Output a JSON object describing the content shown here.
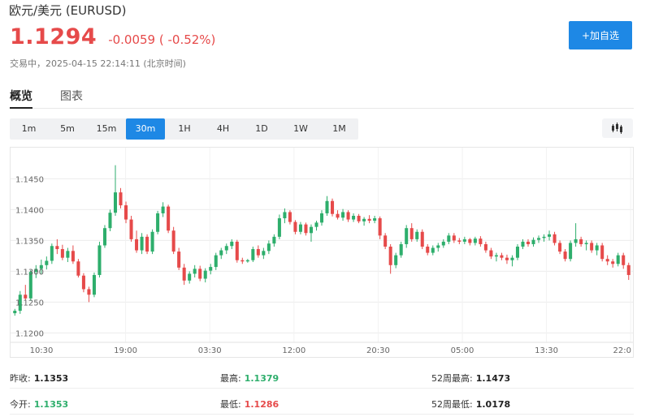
{
  "header": {
    "title": "欧元/美元 (EURUSD)",
    "price": "1.1294",
    "change": "-0.0059 ( -0.52%)",
    "trade_status": "交易中，2025-04-15 22:14:11 (北京时间)",
    "add_button": "+加自选"
  },
  "tabs": [
    {
      "label": "概览",
      "active": true
    },
    {
      "label": "图表",
      "active": false
    }
  ],
  "periods": [
    {
      "label": "1m",
      "active": false
    },
    {
      "label": "5m",
      "active": false
    },
    {
      "label": "15m",
      "active": false
    },
    {
      "label": "30m",
      "active": true
    },
    {
      "label": "1H",
      "active": false
    },
    {
      "label": "4H",
      "active": false
    },
    {
      "label": "1D",
      "active": false
    },
    {
      "label": "1W",
      "active": false
    },
    {
      "label": "1M",
      "active": false
    }
  ],
  "chart_data": {
    "type": "candlestick",
    "ylim": [
      1.119,
      1.149
    ],
    "y_ticks": [
      "1.1450",
      "1.1400",
      "1.1350",
      "1.1300",
      "1.1250",
      "1.1200"
    ],
    "y_tick_values": [
      1.145,
      1.14,
      1.135,
      1.13,
      1.125,
      1.12
    ],
    "x_ticks": [
      "10:30",
      "19:00",
      "03:30",
      "12:00",
      "20:30",
      "05:00",
      "13:30",
      "22:0"
    ],
    "grid": true,
    "up_color": "#2eae6c",
    "down_color": "#e64a4a",
    "candles": [
      [
        1.1232,
        1.1239,
        1.1228,
        1.1236
      ],
      [
        1.1236,
        1.1268,
        1.1231,
        1.1262
      ],
      [
        1.1262,
        1.1278,
        1.1253,
        1.1256
      ],
      [
        1.1256,
        1.1302,
        1.1252,
        1.1299
      ],
      [
        1.1299,
        1.131,
        1.1289,
        1.1304
      ],
      [
        1.1304,
        1.1319,
        1.1296,
        1.131
      ],
      [
        1.131,
        1.1324,
        1.1303,
        1.1317
      ],
      [
        1.1317,
        1.1345,
        1.1312,
        1.1341
      ],
      [
        1.1341,
        1.1352,
        1.1328,
        1.1336
      ],
      [
        1.1336,
        1.1343,
        1.1318,
        1.1322
      ],
      [
        1.1322,
        1.1338,
        1.1315,
        1.1333
      ],
      [
        1.1333,
        1.1342,
        1.1312,
        1.1316
      ],
      [
        1.1316,
        1.132,
        1.129,
        1.1293
      ],
      [
        1.1293,
        1.1297,
        1.1266,
        1.1271
      ],
      [
        1.1271,
        1.1275,
        1.125,
        1.1262
      ],
      [
        1.1262,
        1.1298,
        1.1258,
        1.1294
      ],
      [
        1.1294,
        1.1348,
        1.129,
        1.1342
      ],
      [
        1.1342,
        1.1375,
        1.1338,
        1.137
      ],
      [
        1.137,
        1.14,
        1.1365,
        1.1395
      ],
      [
        1.1395,
        1.1472,
        1.139,
        1.1428
      ],
      [
        1.1428,
        1.1435,
        1.1402,
        1.1407
      ],
      [
        1.1407,
        1.1413,
        1.1378,
        1.1384
      ],
      [
        1.1384,
        1.139,
        1.1348,
        1.1352
      ],
      [
        1.1352,
        1.1366,
        1.133,
        1.1334
      ],
      [
        1.1334,
        1.1362,
        1.1328,
        1.1356
      ],
      [
        1.1356,
        1.136,
        1.1328,
        1.1332
      ],
      [
        1.1332,
        1.1368,
        1.1328,
        1.1364
      ],
      [
        1.1364,
        1.1398,
        1.136,
        1.1394
      ],
      [
        1.1394,
        1.1412,
        1.1388,
        1.1405
      ],
      [
        1.1405,
        1.1408,
        1.1362,
        1.1366
      ],
      [
        1.1366,
        1.1372,
        1.1328,
        1.1332
      ],
      [
        1.1332,
        1.1338,
        1.1302,
        1.1306
      ],
      [
        1.1306,
        1.1312,
        1.1278,
        1.1285
      ],
      [
        1.1285,
        1.13,
        1.128,
        1.1296
      ],
      [
        1.1296,
        1.131,
        1.129,
        1.1304
      ],
      [
        1.1304,
        1.1309,
        1.1284,
        1.1288
      ],
      [
        1.1288,
        1.1305,
        1.1282,
        1.1301
      ],
      [
        1.1301,
        1.1312,
        1.1295,
        1.1307
      ],
      [
        1.1307,
        1.133,
        1.1302,
        1.1326
      ],
      [
        1.1326,
        1.1338,
        1.132,
        1.1334
      ],
      [
        1.1334,
        1.1345,
        1.1328,
        1.1341
      ],
      [
        1.1341,
        1.1352,
        1.1336,
        1.1348
      ],
      [
        1.1348,
        1.1351,
        1.1314,
        1.1318
      ],
      [
        1.1318,
        1.1322,
        1.1312,
        1.1316
      ],
      [
        1.1316,
        1.132,
        1.1314,
        1.1318
      ],
      [
        1.1318,
        1.134,
        1.1315,
        1.1336
      ],
      [
        1.1336,
        1.1342,
        1.1322,
        1.1326
      ],
      [
        1.1326,
        1.1338,
        1.132,
        1.1333
      ],
      [
        1.1333,
        1.135,
        1.1328,
        1.1345
      ],
      [
        1.1345,
        1.136,
        1.134,
        1.1356
      ],
      [
        1.1356,
        1.1392,
        1.1352,
        1.1386
      ],
      [
        1.1386,
        1.1402,
        1.1378,
        1.1396
      ],
      [
        1.1396,
        1.1399,
        1.1376,
        1.138
      ],
      [
        1.138,
        1.1383,
        1.136,
        1.1364
      ],
      [
        1.1364,
        1.138,
        1.136,
        1.1376
      ],
      [
        1.1376,
        1.1379,
        1.1358,
        1.1362
      ],
      [
        1.1362,
        1.1376,
        1.1348,
        1.1372
      ],
      [
        1.1372,
        1.1382,
        1.1366,
        1.1379
      ],
      [
        1.1379,
        1.1399,
        1.1374,
        1.1394
      ],
      [
        1.1394,
        1.1422,
        1.139,
        1.1414
      ],
      [
        1.1414,
        1.1418,
        1.1389,
        1.1393
      ],
      [
        1.1393,
        1.1399,
        1.1384,
        1.1387
      ],
      [
        1.1387,
        1.1401,
        1.1382,
        1.1396
      ],
      [
        1.1396,
        1.1399,
        1.138,
        1.1384
      ],
      [
        1.1384,
        1.1394,
        1.138,
        1.139
      ],
      [
        1.139,
        1.1393,
        1.1378,
        1.1381
      ],
      [
        1.1381,
        1.1388,
        1.1374,
        1.1385
      ],
      [
        1.1385,
        1.1391,
        1.1378,
        1.1382
      ],
      [
        1.1382,
        1.139,
        1.1378,
        1.1386
      ],
      [
        1.1386,
        1.1389,
        1.1352,
        1.1358
      ],
      [
        1.1358,
        1.1362,
        1.1336,
        1.134
      ],
      [
        1.134,
        1.1344,
        1.1296,
        1.131
      ],
      [
        1.131,
        1.133,
        1.1305,
        1.1326
      ],
      [
        1.1326,
        1.1348,
        1.1322,
        1.1344
      ],
      [
        1.1344,
        1.1375,
        1.1338,
        1.137
      ],
      [
        1.137,
        1.1378,
        1.1348,
        1.1352
      ],
      [
        1.1352,
        1.1368,
        1.1348,
        1.1364
      ],
      [
        1.1364,
        1.1368,
        1.1336,
        1.134
      ],
      [
        1.134,
        1.1344,
        1.1326,
        1.133
      ],
      [
        1.133,
        1.1342,
        1.1326,
        1.1338
      ],
      [
        1.1338,
        1.1346,
        1.1332,
        1.1342
      ],
      [
        1.1342,
        1.1352,
        1.1338,
        1.1348
      ],
      [
        1.1348,
        1.1362,
        1.1344,
        1.1358
      ],
      [
        1.1358,
        1.1362,
        1.1346,
        1.135
      ],
      [
        1.135,
        1.1354,
        1.1344,
        1.1348
      ],
      [
        1.1348,
        1.1356,
        1.1344,
        1.1352
      ],
      [
        1.1352,
        1.1354,
        1.1342,
        1.1346
      ],
      [
        1.1346,
        1.1356,
        1.1342,
        1.1353
      ],
      [
        1.1353,
        1.1357,
        1.134,
        1.1344
      ],
      [
        1.1344,
        1.1348,
        1.133,
        1.1334
      ],
      [
        1.1334,
        1.1338,
        1.132,
        1.1324
      ],
      [
        1.1324,
        1.133,
        1.1316,
        1.1326
      ],
      [
        1.1326,
        1.133,
        1.1318,
        1.1322
      ],
      [
        1.1322,
        1.1327,
        1.1312,
        1.1318
      ],
      [
        1.1318,
        1.1326,
        1.1308,
        1.1322
      ],
      [
        1.1322,
        1.1344,
        1.1318,
        1.134
      ],
      [
        1.134,
        1.1352,
        1.1336,
        1.1348
      ],
      [
        1.1348,
        1.1352,
        1.134,
        1.1344
      ],
      [
        1.1344,
        1.1355,
        1.134,
        1.1351
      ],
      [
        1.1351,
        1.1358,
        1.1346,
        1.1354
      ],
      [
        1.1354,
        1.136,
        1.1348,
        1.1356
      ],
      [
        1.1356,
        1.1366,
        1.135,
        1.136
      ],
      [
        1.136,
        1.1364,
        1.1342,
        1.1346
      ],
      [
        1.1346,
        1.135,
        1.1328,
        1.1332
      ],
      [
        1.1332,
        1.1336,
        1.1316,
        1.132
      ],
      [
        1.132,
        1.135,
        1.1316,
        1.1346
      ],
      [
        1.1346,
        1.1378,
        1.134,
        1.1352
      ],
      [
        1.1352,
        1.1356,
        1.134,
        1.1344
      ],
      [
        1.1344,
        1.135,
        1.1334,
        1.1346
      ],
      [
        1.1346,
        1.135,
        1.133,
        1.1334
      ],
      [
        1.1334,
        1.1346,
        1.1326,
        1.1342
      ],
      [
        1.1342,
        1.1346,
        1.1316,
        1.132
      ],
      [
        1.132,
        1.1326,
        1.131,
        1.1316
      ],
      [
        1.1316,
        1.132,
        1.1306,
        1.1312
      ],
      [
        1.1312,
        1.133,
        1.1308,
        1.1326
      ],
      [
        1.1326,
        1.133,
        1.1304,
        1.131
      ],
      [
        1.131,
        1.1314,
        1.1286,
        1.1294
      ]
    ]
  },
  "stats": {
    "rows": [
      [
        {
          "label": "昨收:",
          "value": "1.1353",
          "tone": "neutral"
        },
        {
          "label": "最高:",
          "value": "1.1379",
          "tone": "up"
        },
        {
          "label": "52周最高:",
          "value": "1.1473",
          "tone": "neutral"
        }
      ],
      [
        {
          "label": "今开:",
          "value": "1.1353",
          "tone": "up"
        },
        {
          "label": "最低:",
          "value": "1.1286",
          "tone": "down"
        },
        {
          "label": "52周最低:",
          "value": "1.0178",
          "tone": "neutral"
        }
      ]
    ]
  }
}
